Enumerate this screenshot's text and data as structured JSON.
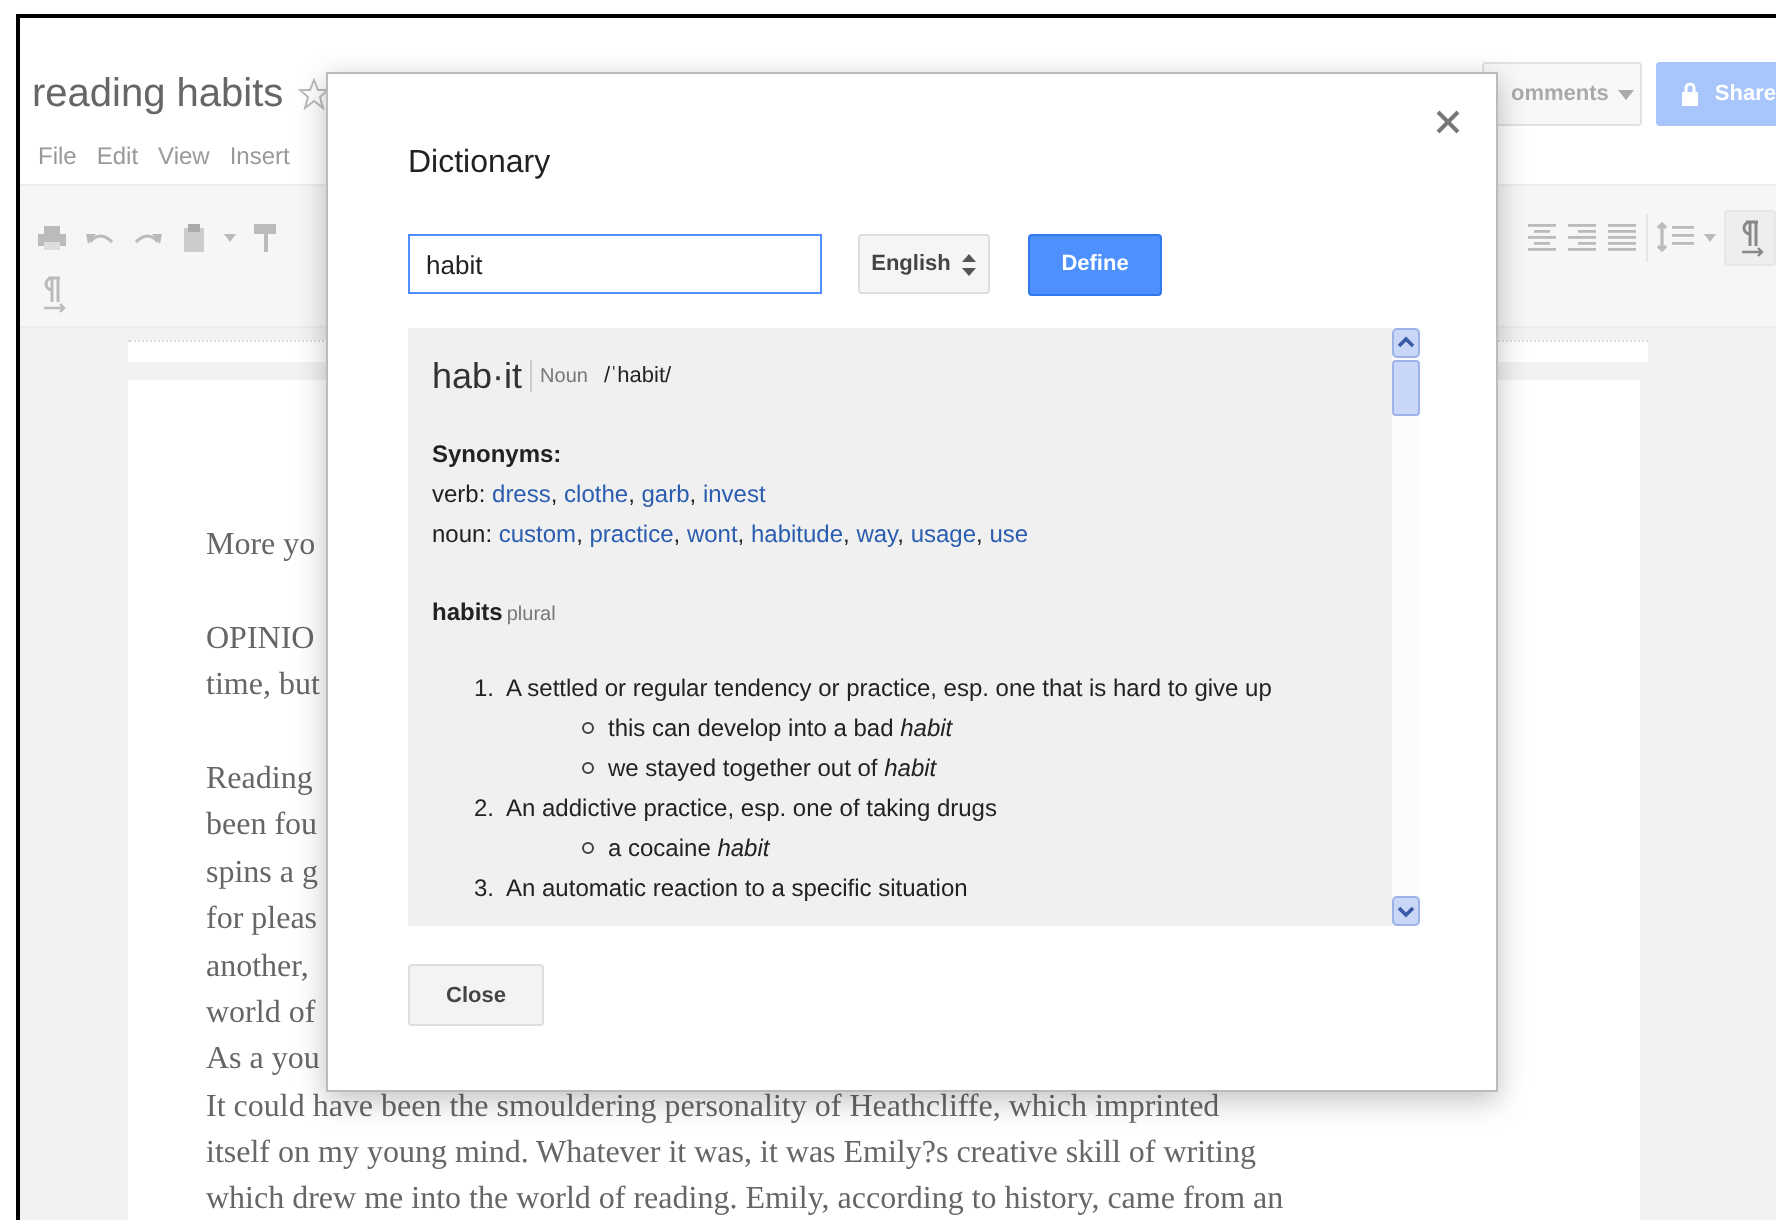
{
  "document": {
    "title": "reading habits",
    "starred": false,
    "menu": [
      "File",
      "Edit",
      "View",
      "Insert"
    ],
    "comments_button": "omments",
    "share_button": "Share",
    "paragraphs": [
      [
        "More yo"
      ],
      [
        "OPINIO",
        "time, but"
      ],
      [
        "Reading",
        "been fou",
        "spins a g",
        "for pleas",
        "another,",
        "world of",
        "As a you",
        "It could have been the smouldering personality of Heathcliffe, which imprinted",
        "itself on my young mind. Whatever it was, it was Emily?s creative skill of writing",
        "which drew me into the world of reading. Emily, according to history, came from an"
      ]
    ]
  },
  "dialog": {
    "title": "Dictionary",
    "search": {
      "value": "habit"
    },
    "language": "English",
    "define_button": "Define",
    "entry": {
      "headword": "hab·it",
      "part_of_speech": "Noun",
      "pronunciation": "/ˈhabit/"
    },
    "synonyms": {
      "heading": "Synonyms:",
      "separator": ",",
      "groups": [
        {
          "label": "verb:",
          "words": [
            "dress",
            "clothe",
            "garb",
            "invest"
          ]
        },
        {
          "label": "noun:",
          "words": [
            "custom",
            "practice",
            "wont",
            "habitude",
            "way",
            "usage",
            "use"
          ]
        }
      ]
    },
    "inflection": {
      "word": "habits",
      "label": "plural"
    },
    "senses": [
      {
        "number": "1.",
        "text": "A settled or regular tendency or practice, esp. one that is hard to give up",
        "examples": [
          "this can develop into a bad *habit*",
          "we stayed together out of *habit*"
        ]
      },
      {
        "number": "2.",
        "text": "An addictive practice, esp. one of taking drugs",
        "examples": [
          "a cocaine *habit*"
        ]
      },
      {
        "number": "3.",
        "text": "An automatic reaction to a specific situation"
      }
    ],
    "close_button": "Close"
  }
}
